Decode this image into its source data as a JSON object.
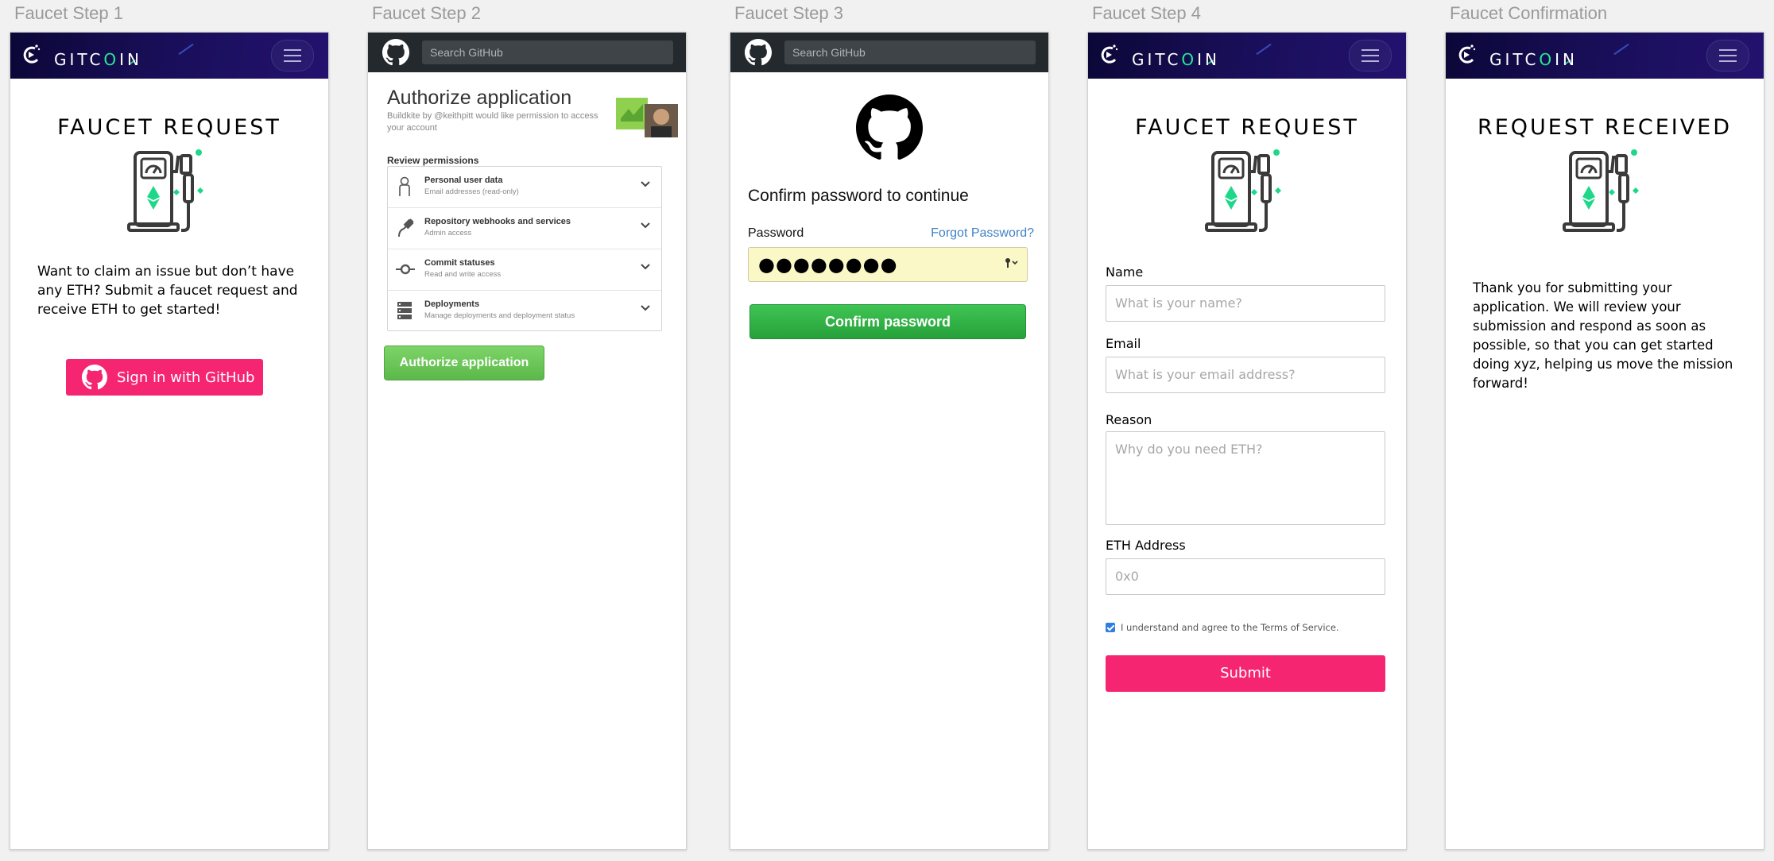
{
  "frames": [
    {
      "label": "Faucet Step 1"
    },
    {
      "label": "Faucet Step 2"
    },
    {
      "label": "Faucet Step 3"
    },
    {
      "label": "Faucet Step 4"
    },
    {
      "label": "Faucet Confirmation"
    }
  ],
  "gitcoin": {
    "word_a": "GITC",
    "word_o": "O",
    "word_b": "IN"
  },
  "step1": {
    "title": "FAUCET REQUEST",
    "text": "Want to claim an issue but don’t have any ETH? Submit a faucet request and receive ETH to get started!",
    "button": "Sign in with GitHub"
  },
  "github": {
    "search_placeholder": "Search GitHub"
  },
  "step2": {
    "title": "Authorize application",
    "subtitle": "Buildkite by @keithpitt would like permission to access your account",
    "review_heading": "Review permissions",
    "permissions": [
      {
        "title": "Personal user data",
        "detail": "Email addresses (read-only)",
        "icon": "person-icon"
      },
      {
        "title": "Repository webhooks and services",
        "detail": "Admin access",
        "icon": "plug-icon"
      },
      {
        "title": "Commit statuses",
        "detail": "Read and write access",
        "icon": "commit-icon"
      },
      {
        "title": "Deployments",
        "detail": "Manage deployments and deployment status",
        "icon": "server-icon"
      }
    ],
    "button": "Authorize application"
  },
  "step3": {
    "title": "Confirm password to continue",
    "password_label": "Password",
    "forgot": "Forgot Password?",
    "password_mask": "●●●●●●●●",
    "button": "Confirm password"
  },
  "step4": {
    "title": "FAUCET REQUEST",
    "name_label": "Name",
    "name_placeholder": "What is your name?",
    "email_label": "Email",
    "email_placeholder": "What is your email address?",
    "reason_label": "Reason",
    "reason_placeholder": "Why do you need ETH?",
    "eth_label": "ETH Address",
    "eth_placeholder": "0x0",
    "terms": "I understand and agree to the Terms of Service.",
    "terms_checked": true,
    "submit": "Submit"
  },
  "confirmation": {
    "title": "REQUEST RECEIVED",
    "text": "Thank you for submitting your application. We will review your submission and respond as soon as possible, so that you can get started doing xyz, helping us move the mission forward!"
  },
  "colors": {
    "accent_pink": "#f52571",
    "gitcoin_green": "#25e899",
    "github_dark": "#24292e",
    "github_green": "#2ebc4f",
    "link_blue": "#4183c4"
  }
}
